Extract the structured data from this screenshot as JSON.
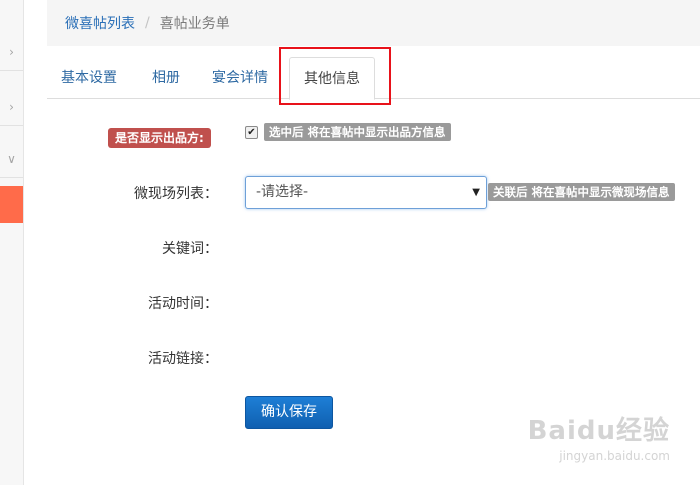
{
  "breadcrumb": {
    "root": "微喜帖列表",
    "separator": "/",
    "current": "喜帖业务单"
  },
  "tabs": [
    {
      "label": "基本设置"
    },
    {
      "label": "相册"
    },
    {
      "label": "宴会详情"
    },
    {
      "label": "其他信息",
      "active": true
    }
  ],
  "form": {
    "show_brand": {
      "label": "是否显示出品方:",
      "checked": true,
      "hint": "选中后 将在喜帖中显示出品方信息"
    },
    "venue_list": {
      "label": "微现场列表：",
      "selected": "-请选择-",
      "hint": "关联后 将在喜帖中显示微现场信息"
    },
    "keywords": {
      "label": "关键词："
    },
    "event_time": {
      "label": "活动时间："
    },
    "event_link": {
      "label": "活动链接："
    },
    "save_label": "确认保存"
  },
  "watermark": {
    "main": "Baidu经验",
    "sub": "jingyan.baidu.com"
  },
  "colors": {
    "accent": "#ff6b4a",
    "link": "#2a6fb7",
    "tag_red": "#c0504d",
    "highlight": "#e8121a",
    "primary_button": "#1e7fd6"
  }
}
